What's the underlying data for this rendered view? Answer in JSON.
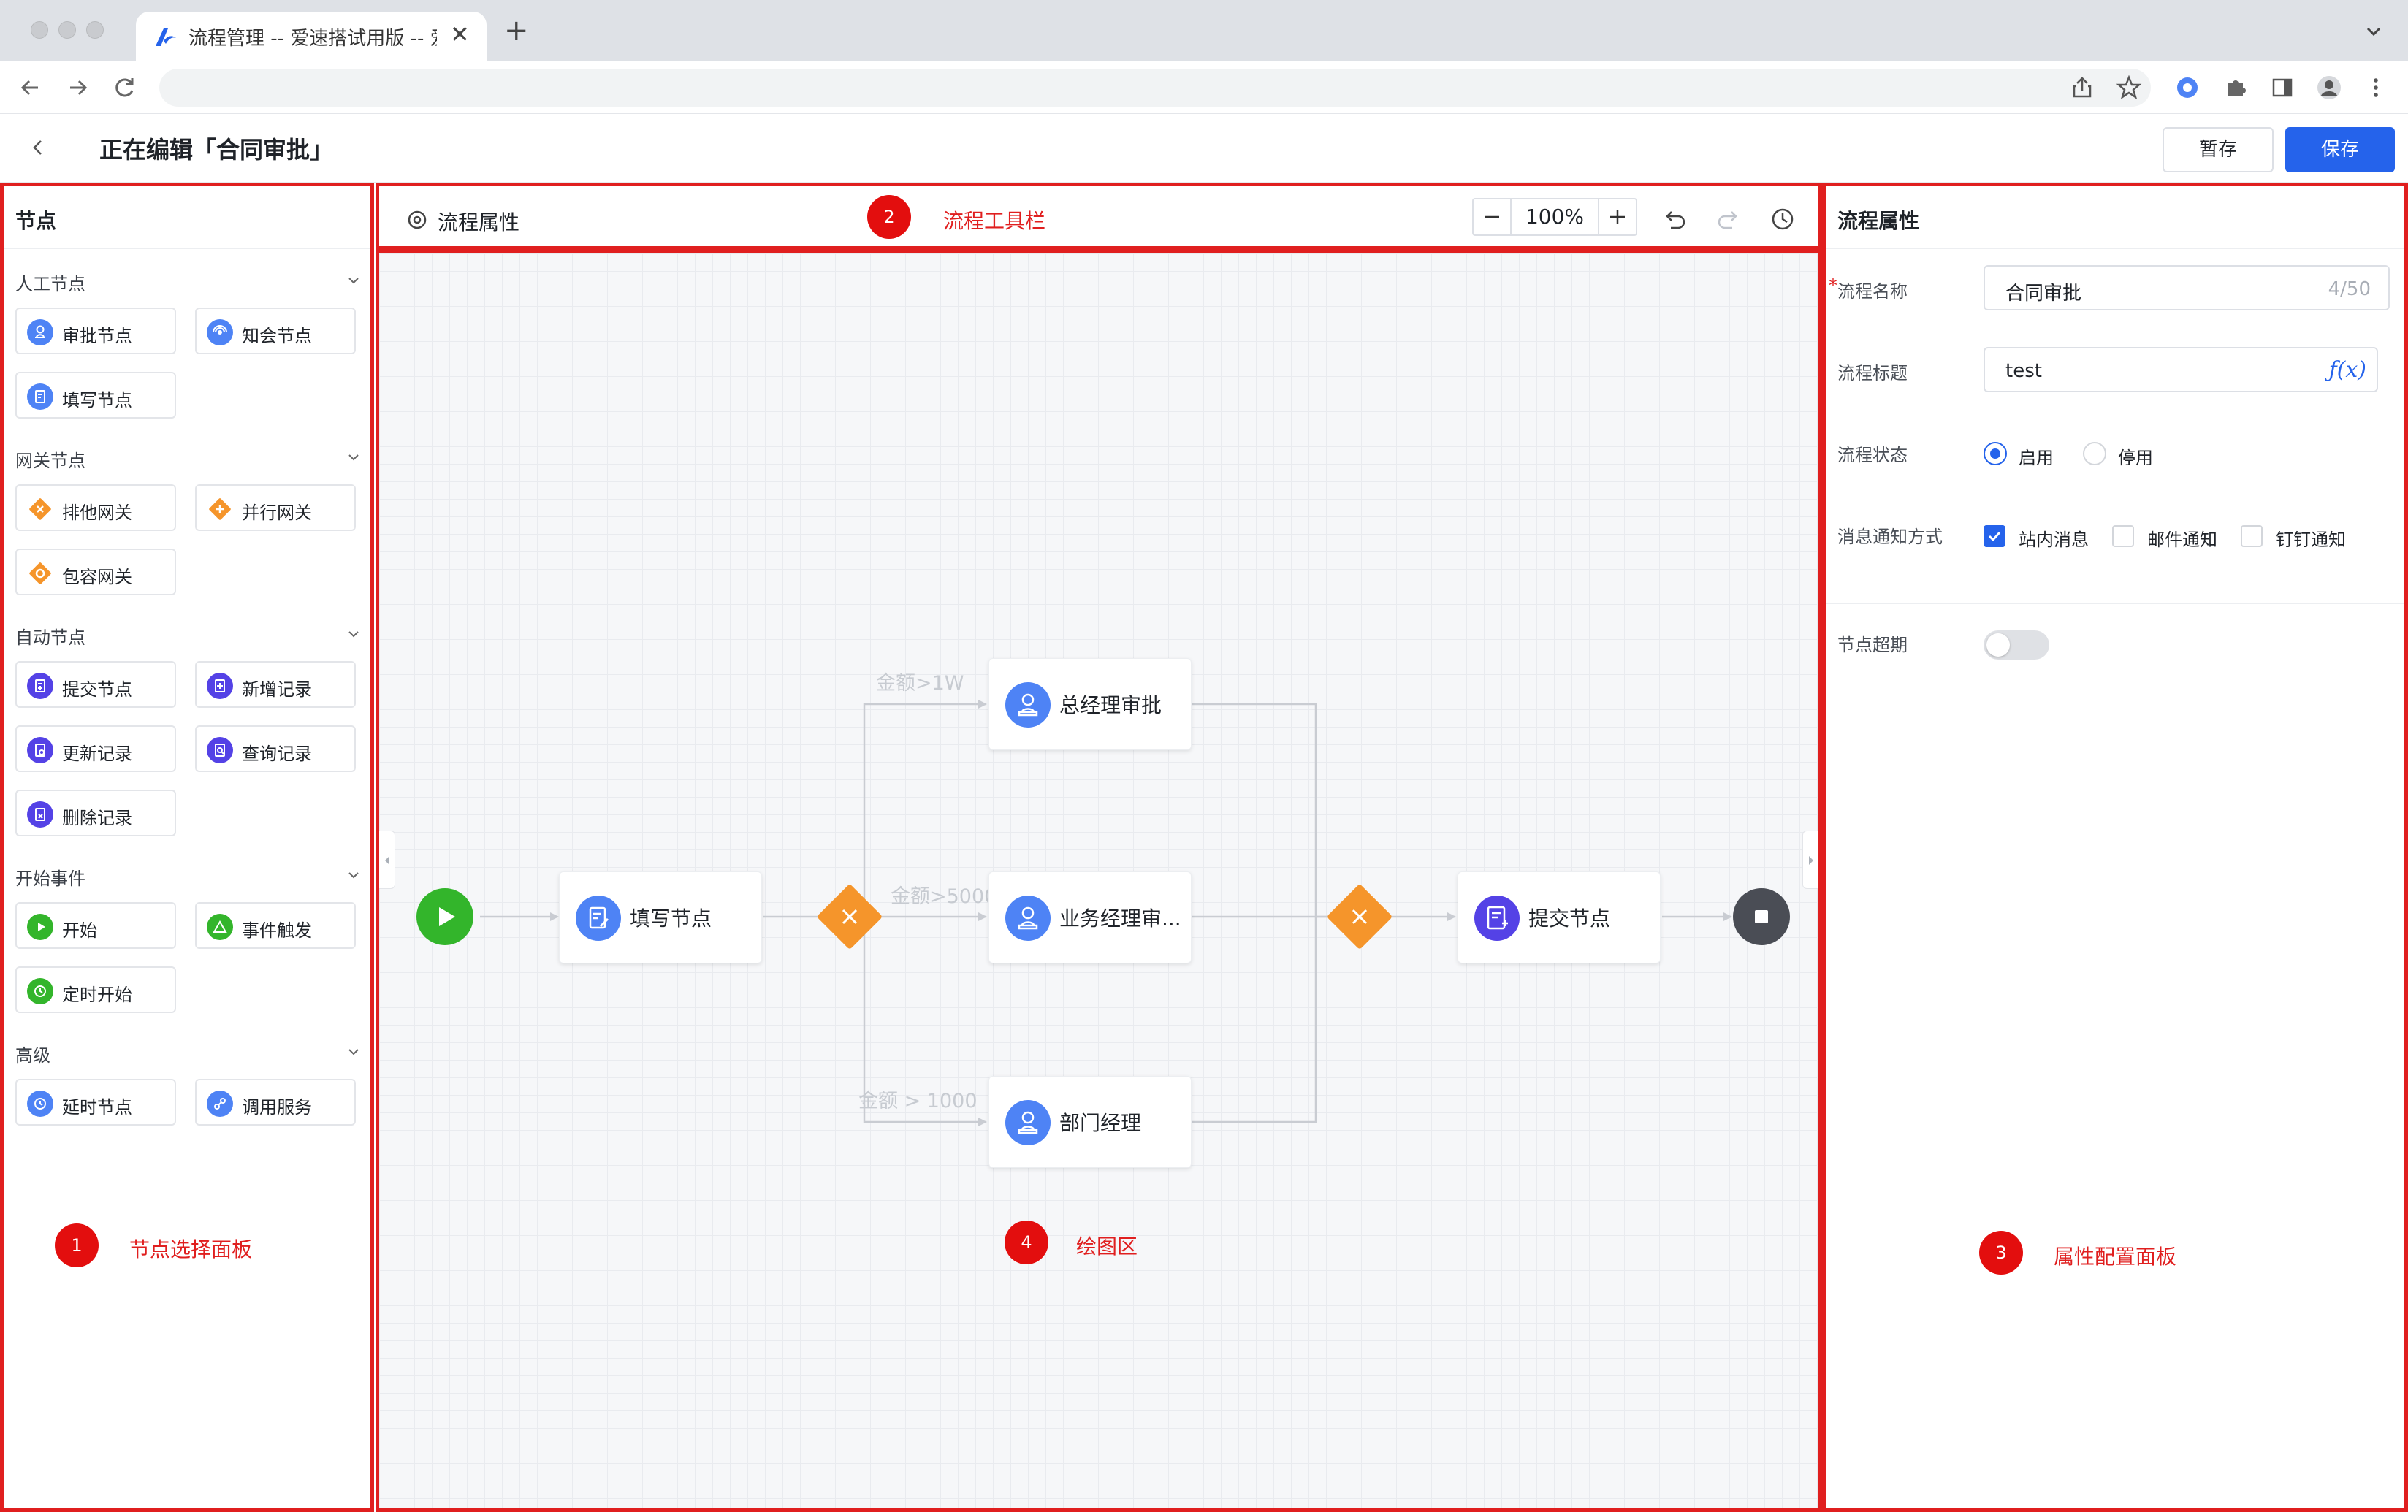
{
  "browser": {
    "tab_title": "流程管理 -- 爱速搭试用版 -- 爱速搭",
    "new_tab": "+",
    "close": "✕"
  },
  "header": {
    "title": "正在编辑「合同审批」",
    "draft_button": "暂存",
    "save_button": "保存"
  },
  "left_panel": {
    "title": "节点",
    "groups": [
      {
        "title": "人工节点",
        "items": [
          {
            "label": "审批节点",
            "icon": "user-approve-icon",
            "color": "#4e83f5"
          },
          {
            "label": "知会节点",
            "icon": "notify-icon",
            "color": "#4e83f5"
          },
          {
            "label": "填写节点",
            "icon": "form-edit-icon",
            "color": "#4e83f5"
          }
        ]
      },
      {
        "title": "网关节点",
        "items": [
          {
            "label": "排他网关",
            "icon": "exclusive-gateway-icon",
            "color": "#f5952b"
          },
          {
            "label": "并行网关",
            "icon": "parallel-gateway-icon",
            "color": "#f5952b"
          },
          {
            "label": "包容网关",
            "icon": "inclusive-gateway-icon",
            "color": "#f5952b"
          }
        ]
      },
      {
        "title": "自动节点",
        "items": [
          {
            "label": "提交节点",
            "icon": "submit-icon",
            "color": "#5442e6"
          },
          {
            "label": "新增记录",
            "icon": "add-record-icon",
            "color": "#5442e6"
          },
          {
            "label": "更新记录",
            "icon": "update-record-icon",
            "color": "#5442e6"
          },
          {
            "label": "查询记录",
            "icon": "query-record-icon",
            "color": "#5442e6"
          },
          {
            "label": "删除记录",
            "icon": "delete-record-icon",
            "color": "#5442e6"
          }
        ]
      },
      {
        "title": "开始事件",
        "items": [
          {
            "label": "开始",
            "icon": "start-play-icon",
            "color": "#33b52b"
          },
          {
            "label": "事件触发",
            "icon": "event-trigger-icon",
            "color": "#33b52b"
          },
          {
            "label": "定时开始",
            "icon": "timer-start-icon",
            "color": "#33b52b"
          }
        ]
      },
      {
        "title": "高级",
        "items": [
          {
            "label": "延时节点",
            "icon": "delay-clock-icon",
            "color": "#4e83f5"
          },
          {
            "label": "调用服务",
            "icon": "call-service-icon",
            "color": "#4e83f5"
          }
        ]
      }
    ]
  },
  "toolbar": {
    "flow_properties": "流程属性",
    "zoom": "100%"
  },
  "canvas": {
    "nodes": {
      "fill": "填写节点",
      "gm": "总经理审批",
      "bm": "业务经理审...",
      "dept": "部门经理",
      "submit": "提交节点"
    },
    "edge_labels": {
      "top": "金额>1W",
      "mid": "金额>5000",
      "bottom": "金额 > 1000"
    }
  },
  "right_panel": {
    "title": "流程属性",
    "required_mark": "*",
    "fields": {
      "name_label": "流程名称",
      "name_value": "合同审批",
      "name_count": "4/50",
      "title_label": "流程标题",
      "title_value": "test",
      "title_fx": "ƒ(x)",
      "status_label": "流程状态",
      "status_on": "启用",
      "status_off": "停用",
      "notify_label": "消息通知方式",
      "notify_site": "站内消息",
      "notify_mail": "邮件通知",
      "notify_ding": "钉钉通知",
      "timeout_label": "节点超期"
    }
  },
  "annotations": {
    "badge1": "1",
    "label1": "节点选择面板",
    "badge2": "2",
    "label2": "流程工具栏",
    "badge3": "3",
    "label3": "属性配置面板",
    "badge4": "4",
    "label4": "绘图区"
  },
  "colors": {
    "accent": "#2563eb",
    "annotation_red": "#e01f1f",
    "gateway_orange": "#f5952b",
    "start_green": "#33b52b",
    "end_dark": "#4a4d55",
    "human_blue": "#4e83f5",
    "auto_purple": "#5442e6"
  }
}
